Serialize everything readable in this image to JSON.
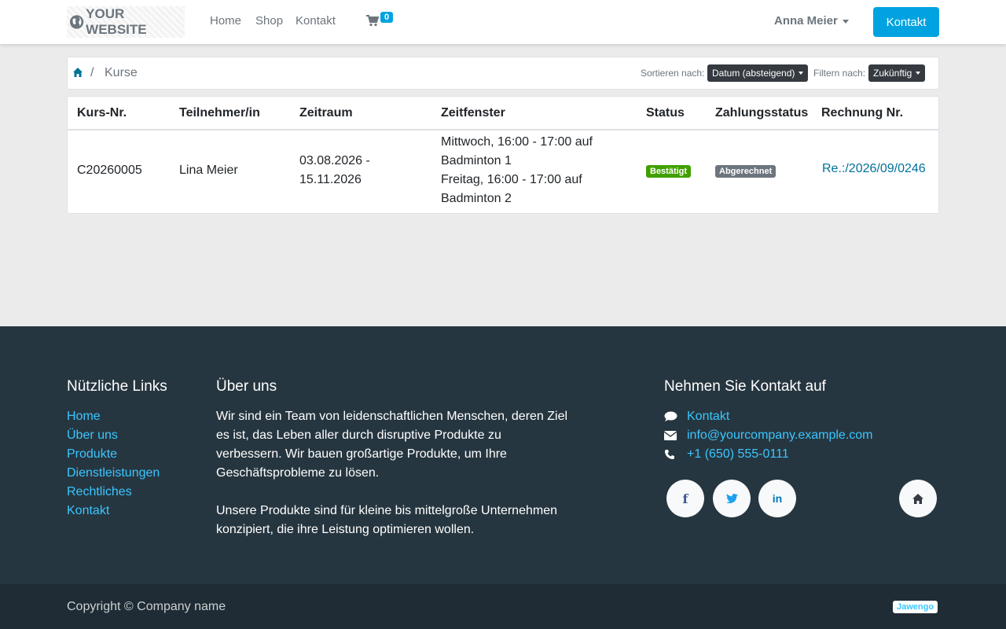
{
  "colors": {
    "primary": "#00a3e0",
    "link": "#00729a",
    "footer_bg": "#263640",
    "footer_link": "#3ac6ff",
    "success": "#40a000",
    "secondary": "#6c757d"
  },
  "header": {
    "logo_text": "YOUR WEBSITE",
    "nav": [
      "Home",
      "Shop",
      "Kontakt"
    ],
    "cart_count": "0",
    "user_name": "Anna Meier",
    "contact_button": "Kontakt"
  },
  "breadcrumb": {
    "current": "Kurse"
  },
  "toolbar": {
    "sort_label": "Sortieren nach:",
    "sort_value": "Datum (absteigend)",
    "filter_label": "Filtern nach:",
    "filter_value": "Zukünftig"
  },
  "table": {
    "headers": [
      "Kurs-Nr.",
      "Teilnehmer/in",
      "Zeitraum",
      "Zeitfenster",
      "Status",
      "Zahlungsstatus",
      "Rechnung Nr."
    ],
    "rows": [
      {
        "course_no": "C20260005",
        "participant": "Lina Meier",
        "period_line1": "03.08.2026 -",
        "period_line2": "15.11.2026",
        "slot_line1": "Mittwoch, 16:00 - 17:00 auf",
        "slot_line2": "Badminton 1",
        "slot_line3": "Freitag, 16:00 - 17:00 auf",
        "slot_line4": "Badminton 2",
        "status": "Bestätigt",
        "payment_status": "Abgerechnet",
        "invoice": "Re.:/2026/09/0246"
      }
    ]
  },
  "footer": {
    "links_title": "Nützliche Links",
    "links": [
      "Home",
      "Über uns",
      "Produkte",
      "Dienstleistungen",
      "Rechtliches",
      "Kontakt"
    ],
    "about_title": "Über uns",
    "about_p1": "Wir sind ein Team von leidenschaftlichen Menschen, deren Ziel es ist, das Leben aller durch disruptive Produkte zu verbessern. Wir bauen großartige Produkte, um Ihre Geschäftsprobleme zu lösen.",
    "about_p2": "Unsere Produkte sind für kleine bis mittelgroße Unternehmen konzipiert, die ihre Leistung optimieren wollen.",
    "contact_title": "Nehmen Sie Kontakt auf",
    "contact_link": "Kontakt",
    "email": "info@yourcompany.example.com",
    "phone": "+1 (650) 555-0111",
    "copyright": "Copyright © Company name",
    "brand": "Jawengo"
  }
}
